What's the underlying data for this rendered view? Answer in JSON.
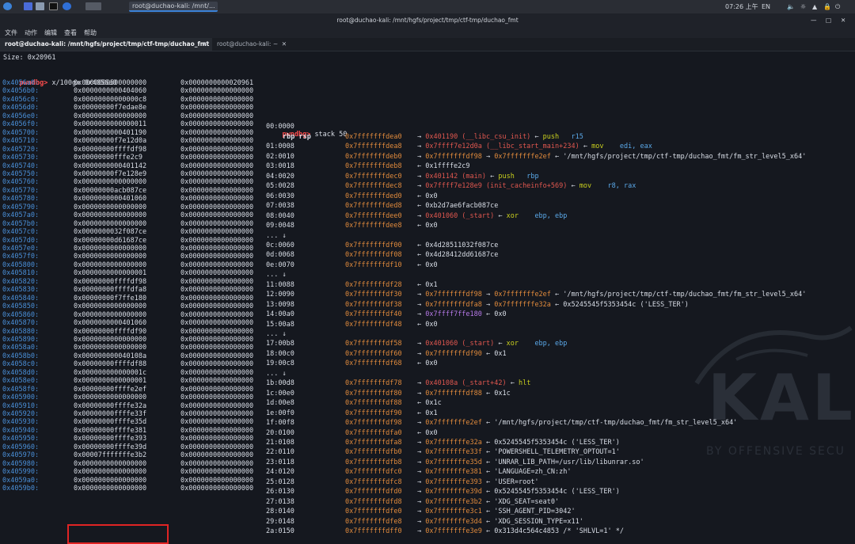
{
  "taskbar": {
    "window_title": "root@duchao-kali: /mnt/...",
    "time": "07:26 上午",
    "lang": "EN"
  },
  "window": {
    "title": "root@duchao-kali: /mnt/hgfs/project/tmp/ctf-tmp/duchao_fmt"
  },
  "menu": [
    "文件",
    "动作",
    "编辑",
    "查看",
    "帮助"
  ],
  "tabs": [
    {
      "label": "root@duchao-kali: /mnt/hgfs/project/tmp/ctf-tmp/duchao_fmt",
      "active": true
    },
    {
      "label": "root@duchao-kali: ~",
      "active": false
    }
  ],
  "terminal": {
    "size_line": "Size: 0x20961",
    "prompt": "pwndbg>",
    "x_cmd": "x/100gx 0x4056a0",
    "stack_cmd": "stack 50",
    "rbp_rsp": "rbp rsp",
    "ellipsis": "... ↓",
    "hexdump": [
      [
        "0x4056a0:",
        "0x0000000500000000",
        "0x0000000000020961"
      ],
      [
        "0x4056b0:",
        "0x0000000000404060",
        "0x0000000000000000"
      ],
      [
        "0x4056c0:",
        "0x00000000000000c8",
        "0x0000000000000000"
      ],
      [
        "0x4056d0:",
        "0x00000000f7edae8e",
        "0x0000000000000000"
      ],
      [
        "0x4056e0:",
        "0x0000000000000000",
        "0x0000000000000000"
      ],
      [
        "0x4056f0:",
        "0x0000000000000011",
        "0x0000000000000000"
      ],
      [
        "0x405700:",
        "0x0000000000401190",
        "0x0000000000000000"
      ],
      [
        "0x405710:",
        "0x00000000f7e12d0a",
        "0x0000000000000000"
      ],
      [
        "0x405720:",
        "0x00000000ffffdf98",
        "0x0000000000000000"
      ],
      [
        "0x405730:",
        "0x00000000fffe2c9",
        "0x0000000000000000"
      ],
      [
        "0x405740:",
        "0x0000000000401142",
        "0x0000000000000000"
      ],
      [
        "0x405750:",
        "0x00000000f7e128e9",
        "0x0000000000000000"
      ],
      [
        "0x405760:",
        "0x0000000000000000",
        "0x0000000000000000"
      ],
      [
        "0x405770:",
        "0x00000000acb087ce",
        "0x0000000000000000"
      ],
      [
        "0x405780:",
        "0x0000000000401060",
        "0x0000000000000000"
      ],
      [
        "0x405790:",
        "0x0000000000000000",
        "0x0000000000000000"
      ],
      [
        "0x4057a0:",
        "0x0000000000000000",
        "0x0000000000000000"
      ],
      [
        "0x4057b0:",
        "0x0000000000000000",
        "0x0000000000000000"
      ],
      [
        "0x4057c0:",
        "0x0000000032f087ce",
        "0x0000000000000000"
      ],
      [
        "0x4057d0:",
        "0x00000000d61687ce",
        "0x0000000000000000"
      ],
      [
        "0x4057e0:",
        "0x0000000000000000",
        "0x0000000000000000"
      ],
      [
        "0x4057f0:",
        "0x0000000000000000",
        "0x0000000000000000"
      ],
      [
        "0x405800:",
        "0x0000000000000000",
        "0x0000000000000000"
      ],
      [
        "0x405810:",
        "0x0000000000000001",
        "0x0000000000000000"
      ],
      [
        "0x405820:",
        "0x00000000ffffdf98",
        "0x0000000000000000"
      ],
      [
        "0x405830:",
        "0x00000000ffffdfa8",
        "0x0000000000000000"
      ],
      [
        "0x405840:",
        "0x00000000f7ffe180",
        "0x0000000000000000"
      ],
      [
        "0x405850:",
        "0x0000000000000000",
        "0x0000000000000000"
      ],
      [
        "0x405860:",
        "0x0000000000000000",
        "0x0000000000000000"
      ],
      [
        "0x405870:",
        "0x0000000000401060",
        "0x0000000000000000"
      ],
      [
        "0x405880:",
        "0x00000000ffffdf90",
        "0x0000000000000000"
      ],
      [
        "0x405890:",
        "0x0000000000000000",
        "0x0000000000000000"
      ],
      [
        "0x4058a0:",
        "0x0000000000000000",
        "0x0000000000000000"
      ],
      [
        "0x4058b0:",
        "0x000000000040108a",
        "0x0000000000000000"
      ],
      [
        "0x4058c0:",
        "0x00000000ffffdf88",
        "0x0000000000000000"
      ],
      [
        "0x4058d0:",
        "0x000000000000001c",
        "0x0000000000000000"
      ],
      [
        "0x4058e0:",
        "0x0000000000000001",
        "0x0000000000000000"
      ],
      [
        "0x4058f0:",
        "0x00000000ffffe2ef",
        "0x0000000000000000"
      ],
      [
        "0x405900:",
        "0x0000000000000000",
        "0x0000000000000000"
      ],
      [
        "0x405910:",
        "0x00000000ffffe32a",
        "0x0000000000000000"
      ],
      [
        "0x405920:",
        "0x00000000ffffe33f",
        "0x0000000000000000"
      ],
      [
        "0x405930:",
        "0x00000000ffffe35d",
        "0x0000000000000000"
      ],
      [
        "0x405940:",
        "0x00000000ffffe381",
        "0x0000000000000000"
      ],
      [
        "0x405950:",
        "0x00000000ffffe393",
        "0x0000000000000000"
      ],
      [
        "0x405960:",
        "0x00000000ffffe39d",
        "0x0000000000000000"
      ],
      [
        "0x405970:",
        "0x00007fffffffe3b2",
        "0x0000000000000000"
      ],
      [
        "0x405980:",
        "0x0000000000000000",
        "0x0000000000000000"
      ],
      [
        "0x405990:",
        "0x0000000000000000",
        "0x0000000000000000"
      ],
      [
        "0x4059a0:",
        "0x0000000000000000",
        "0x0000000000000000"
      ],
      [
        "0x4059b0:",
        "0x0000000000000000",
        "0x0000000000000000"
      ]
    ],
    "stack": [
      {
        "o": "00:0000",
        "a": "0x7fffffffdea0",
        "s": [
          [
            "→ ",
            "white"
          ],
          [
            "0x401190 (__libc_csu_init)",
            "redaddr"
          ],
          [
            " ← ",
            "white"
          ],
          [
            "push   ",
            "green"
          ],
          [
            "r15",
            "cyan"
          ]
        ]
      },
      {
        "o": "01:0008",
        "a": "0x7fffffffdea8",
        "s": [
          [
            "→ ",
            "white"
          ],
          [
            "0x7ffff7e12d0a (__libc_start_main+234)",
            "redaddr"
          ],
          [
            " ← ",
            "white"
          ],
          [
            "mov    ",
            "green"
          ],
          [
            "edi, eax",
            "cyan"
          ]
        ]
      },
      {
        "o": "02:0010",
        "a": "0x7fffffffdeb0",
        "s": [
          [
            "→ ",
            "white"
          ],
          [
            "0x7fffffffdf98",
            "orange"
          ],
          [
            " → ",
            "white"
          ],
          [
            "0x7fffffffe2ef",
            "orange"
          ],
          [
            " ← '/mnt/hgfs/project/tmp/ctf-tmp/duchao_fmt/fm_str_level5_x64'",
            "white"
          ]
        ]
      },
      {
        "o": "03:0018",
        "a": "0x7fffffffdeb8",
        "s": [
          [
            "← 0x1ffffe2c9",
            "white"
          ]
        ]
      },
      {
        "o": "04:0020",
        "a": "0x7fffffffdec0",
        "s": [
          [
            "→ ",
            "white"
          ],
          [
            "0x401142 (main)",
            "redaddr"
          ],
          [
            " ← ",
            "white"
          ],
          [
            "push   ",
            "green"
          ],
          [
            "rbp",
            "cyan"
          ]
        ]
      },
      {
        "o": "05:0028",
        "a": "0x7fffffffdec8",
        "s": [
          [
            "→ ",
            "white"
          ],
          [
            "0x7ffff7e128e9 (init_cacheinfo+569)",
            "redaddr"
          ],
          [
            " ← ",
            "white"
          ],
          [
            "mov    ",
            "green"
          ],
          [
            "r8, rax",
            "cyan"
          ]
        ]
      },
      {
        "o": "06:0030",
        "a": "0x7fffffffded0",
        "s": [
          [
            "← 0x0",
            "white"
          ]
        ]
      },
      {
        "o": "07:0038",
        "a": "0x7fffffffded8",
        "s": [
          [
            "← 0xb2d7ae6facb087ce",
            "white"
          ]
        ]
      },
      {
        "o": "08:0040",
        "a": "0x7fffffffdee0",
        "s": [
          [
            "→ ",
            "white"
          ],
          [
            "0x401060 (_start)",
            "redaddr"
          ],
          [
            " ← ",
            "white"
          ],
          [
            "xor    ",
            "green"
          ],
          [
            "ebp, ebp",
            "cyan"
          ]
        ]
      },
      {
        "o": "09:0048",
        "a": "0x7fffffffdee8",
        "s": [
          [
            "← 0x0",
            "white"
          ]
        ]
      },
      {
        "ell": true
      },
      {
        "o": "0c:0060",
        "a": "0x7fffffffdf00",
        "s": [
          [
            "← 0x4d28511032f087ce",
            "white"
          ]
        ]
      },
      {
        "o": "0d:0068",
        "a": "0x7fffffffdf08",
        "s": [
          [
            "← 0x4d28412dd61687ce",
            "white"
          ]
        ]
      },
      {
        "o": "0e:0070",
        "a": "0x7fffffffdf10",
        "s": [
          [
            "← 0x0",
            "white"
          ]
        ]
      },
      {
        "ell": true
      },
      {
        "o": "11:0088",
        "a": "0x7fffffffdf28",
        "s": [
          [
            "← 0x1",
            "white"
          ]
        ]
      },
      {
        "o": "12:0090",
        "a": "0x7fffffffdf30",
        "s": [
          [
            "→ ",
            "white"
          ],
          [
            "0x7fffffffdf98",
            "orange"
          ],
          [
            " → ",
            "white"
          ],
          [
            "0x7fffffffe2ef",
            "orange"
          ],
          [
            " ← '/mnt/hgfs/project/tmp/ctf-tmp/duchao_fmt/fm_str_level5_x64'",
            "white"
          ]
        ]
      },
      {
        "o": "13:0098",
        "a": "0x7fffffffdf38",
        "s": [
          [
            "→ ",
            "white"
          ],
          [
            "0x7fffffffdfa8",
            "orange"
          ],
          [
            " → ",
            "white"
          ],
          [
            "0x7fffffffe32a",
            "orange"
          ],
          [
            " ← 0x5245545f5353454c ('LESS_TER')",
            "white"
          ]
        ]
      },
      {
        "o": "14:00a0",
        "a": "0x7fffffffdf40",
        "s": [
          [
            "→ ",
            "white"
          ],
          [
            "0x7ffff7ffe180",
            "purple"
          ],
          [
            " ← 0x0",
            "white"
          ]
        ]
      },
      {
        "o": "15:00a8",
        "a": "0x7fffffffdf48",
        "s": [
          [
            "← 0x0",
            "white"
          ]
        ]
      },
      {
        "ell": true
      },
      {
        "o": "17:00b8",
        "a": "0x7fffffffdf58",
        "s": [
          [
            "→ ",
            "white"
          ],
          [
            "0x401060 (_start)",
            "redaddr"
          ],
          [
            " ← ",
            "white"
          ],
          [
            "xor    ",
            "green"
          ],
          [
            "ebp, ebp",
            "cyan"
          ]
        ]
      },
      {
        "o": "18:00c0",
        "a": "0x7fffffffdf60",
        "s": [
          [
            "→ ",
            "white"
          ],
          [
            "0x7fffffffdf90",
            "orange"
          ],
          [
            " ← 0x1",
            "white"
          ]
        ]
      },
      {
        "o": "19:00c8",
        "a": "0x7fffffffdf68",
        "s": [
          [
            "← 0x0",
            "white"
          ]
        ]
      },
      {
        "ell": true
      },
      {
        "o": "1b:00d8",
        "a": "0x7fffffffdf78",
        "s": [
          [
            "→ ",
            "white"
          ],
          [
            "0x40108a (_start+42)",
            "redaddr"
          ],
          [
            " ← ",
            "white"
          ],
          [
            "hlt",
            "green"
          ]
        ]
      },
      {
        "o": "1c:00e0",
        "a": "0x7fffffffdf80",
        "s": [
          [
            "→ ",
            "white"
          ],
          [
            "0x7fffffffdf88",
            "orange"
          ],
          [
            " ← 0x1c",
            "white"
          ]
        ]
      },
      {
        "o": "1d:00e8",
        "a": "0x7fffffffdf88",
        "s": [
          [
            "← 0x1c",
            "white"
          ]
        ]
      },
      {
        "o": "1e:00f0",
        "a": "0x7fffffffdf90",
        "s": [
          [
            "← 0x1",
            "white"
          ]
        ]
      },
      {
        "o": "1f:00f8",
        "a": "0x7fffffffdf98",
        "s": [
          [
            "→ ",
            "white"
          ],
          [
            "0x7fffffffe2ef",
            "orange"
          ],
          [
            " ← '/mnt/hgfs/project/tmp/ctf-tmp/duchao_fmt/fm_str_level5_x64'",
            "white"
          ]
        ]
      },
      {
        "o": "20:0100",
        "a": "0x7fffffffdfa0",
        "s": [
          [
            "← 0x0",
            "white"
          ]
        ]
      },
      {
        "o": "21:0108",
        "a": "0x7fffffffdfa8",
        "s": [
          [
            "→ ",
            "white"
          ],
          [
            "0x7fffffffe32a",
            "orange"
          ],
          [
            " ← 0x5245545f5353454c ('LESS_TER')",
            "white"
          ]
        ]
      },
      {
        "o": "22:0110",
        "a": "0x7fffffffdfb0",
        "s": [
          [
            "→ ",
            "white"
          ],
          [
            "0x7fffffffe33f",
            "orange"
          ],
          [
            " ← 'POWERSHELL_TELEMETRY_OPTOUT=1'",
            "white"
          ]
        ]
      },
      {
        "o": "23:0118",
        "a": "0x7fffffffdfb8",
        "s": [
          [
            "→ ",
            "white"
          ],
          [
            "0x7fffffffe35d",
            "orange"
          ],
          [
            " ← 'UNRAR_LIB_PATH=/usr/lib/libunrar.so'",
            "white"
          ]
        ]
      },
      {
        "o": "24:0120",
        "a": "0x7fffffffdfc0",
        "s": [
          [
            "→ ",
            "white"
          ],
          [
            "0x7fffffffe381",
            "orange"
          ],
          [
            " ← 'LANGUAGE=zh_CN:zh'",
            "white"
          ]
        ]
      },
      {
        "o": "25:0128",
        "a": "0x7fffffffdfc8",
        "s": [
          [
            "→ ",
            "white"
          ],
          [
            "0x7fffffffe393",
            "orange"
          ],
          [
            " ← 'USER=root'",
            "white"
          ]
        ]
      },
      {
        "o": "26:0130",
        "a": "0x7fffffffdfd0",
        "s": [
          [
            "→ ",
            "white"
          ],
          [
            "0x7fffffffe39d",
            "orange"
          ],
          [
            " ← 0x5245545f5353454c ('LESS_TER')",
            "white"
          ]
        ]
      },
      {
        "o": "27:0138",
        "a": "0x7fffffffdfd8",
        "s": [
          [
            "→ ",
            "white"
          ],
          [
            "0x7fffffffe3b2",
            "orange"
          ],
          [
            " ← 'XDG_SEAT=seat0'",
            "white"
          ]
        ]
      },
      {
        "o": "28:0140",
        "a": "0x7fffffffdfe0",
        "s": [
          [
            "→ ",
            "white"
          ],
          [
            "0x7fffffffe3c1",
            "orange"
          ],
          [
            " ← 'SSH_AGENT_PID=3042'",
            "white"
          ]
        ]
      },
      {
        "o": "29:0148",
        "a": "0x7fffffffdfe8",
        "s": [
          [
            "→ ",
            "white"
          ],
          [
            "0x7fffffffe3d4",
            "orange"
          ],
          [
            " ← 'XDG_SESSION_TYPE=x11'",
            "white"
          ]
        ]
      },
      {
        "o": "2a:0150",
        "a": "0x7fffffffdff0",
        "s": [
          [
            "→ ",
            "white"
          ],
          [
            "0x7fffffffe3e9",
            "orange"
          ],
          [
            " ← 0x313d4c564c4853 /* 'SHLVL=1' */",
            "white"
          ]
        ]
      }
    ]
  },
  "watermark": {
    "big": "KAL",
    "small": "BY OFFENSIVE SECU"
  },
  "colors": {
    "accent": "#3b82d8",
    "prompt": "#ff4d4d",
    "address": "#4a8fd8",
    "highlight": "#e02424"
  }
}
